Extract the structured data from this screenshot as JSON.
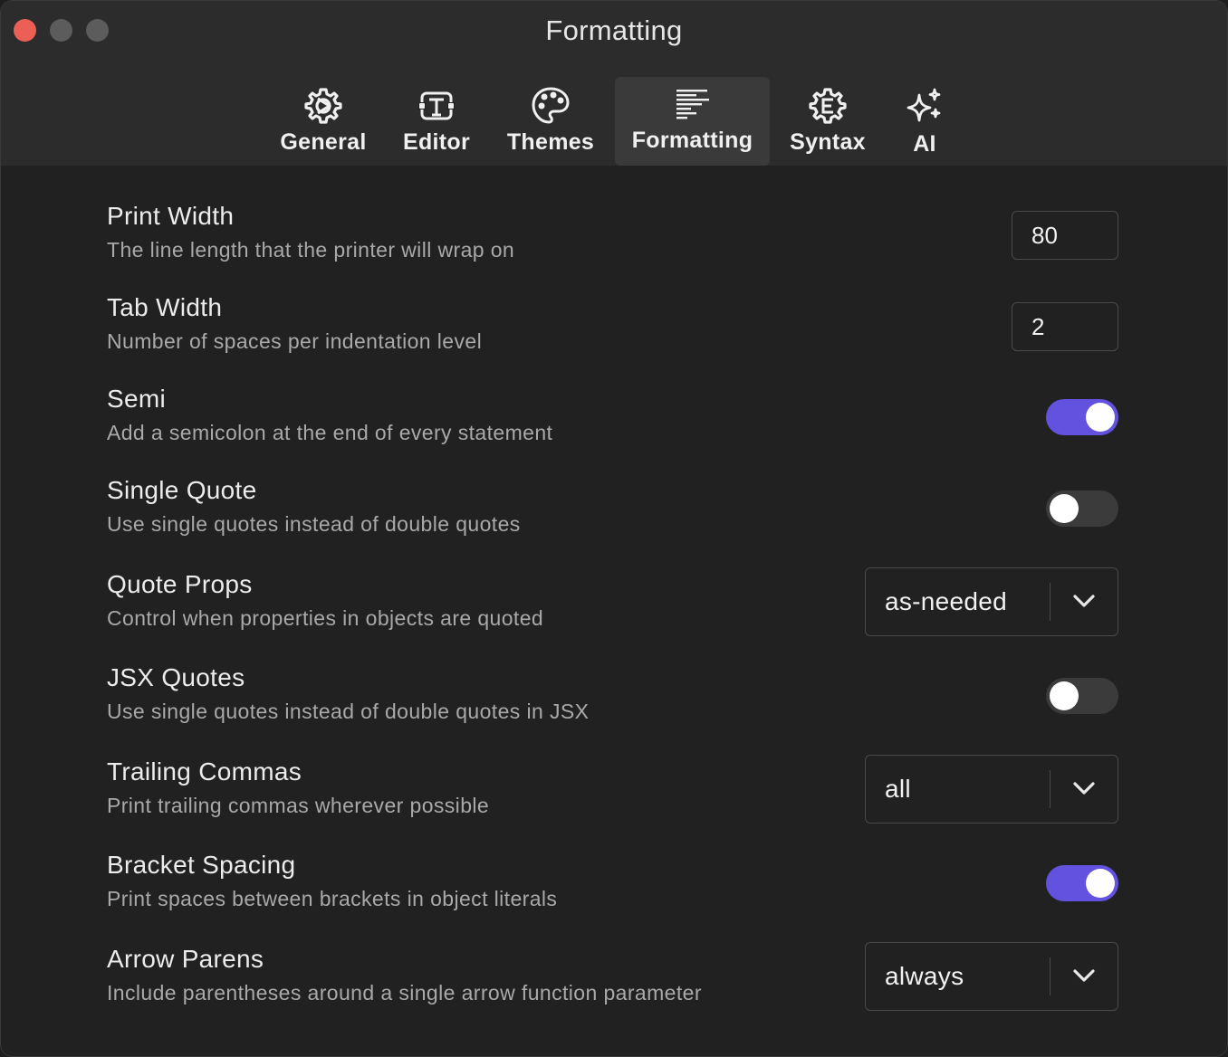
{
  "window": {
    "title": "Formatting"
  },
  "tabs": [
    {
      "label": "General",
      "icon": "gear-icon",
      "active": false
    },
    {
      "label": "Editor",
      "icon": "text-box-icon",
      "active": false
    },
    {
      "label": "Themes",
      "icon": "palette-icon",
      "active": false
    },
    {
      "label": "Formatting",
      "icon": "text-align-icon",
      "active": true
    },
    {
      "label": "Syntax",
      "icon": "syntax-gear-icon",
      "active": false
    },
    {
      "label": "AI",
      "icon": "sparkles-icon",
      "active": false
    }
  ],
  "settings": {
    "print_width": {
      "title": "Print Width",
      "description": "The line length that the printer will wrap on",
      "value": "80"
    },
    "tab_width": {
      "title": "Tab Width",
      "description": "Number of spaces per indentation level",
      "value": "2"
    },
    "semi": {
      "title": "Semi",
      "description": "Add a semicolon at the end of every statement",
      "enabled": true
    },
    "single_quote": {
      "title": "Single Quote",
      "description": "Use single quotes instead of double quotes",
      "enabled": false
    },
    "quote_props": {
      "title": "Quote Props",
      "description": "Control when properties in objects are quoted",
      "value": "as-needed"
    },
    "jsx_quotes": {
      "title": "JSX Quotes",
      "description": "Use single quotes instead of double quotes in JSX",
      "enabled": false
    },
    "trailing_commas": {
      "title": "Trailing Commas",
      "description": "Print trailing commas wherever possible",
      "value": "all"
    },
    "bracket_spacing": {
      "title": "Bracket Spacing",
      "description": "Print spaces between brackets in object literals",
      "enabled": true
    },
    "arrow_parens": {
      "title": "Arrow Parens",
      "description": "Include parentheses around a single arrow function parameter",
      "value": "always"
    }
  },
  "colors": {
    "accent": "#6352e0",
    "close": "#ec5f57",
    "background": "#212121"
  }
}
